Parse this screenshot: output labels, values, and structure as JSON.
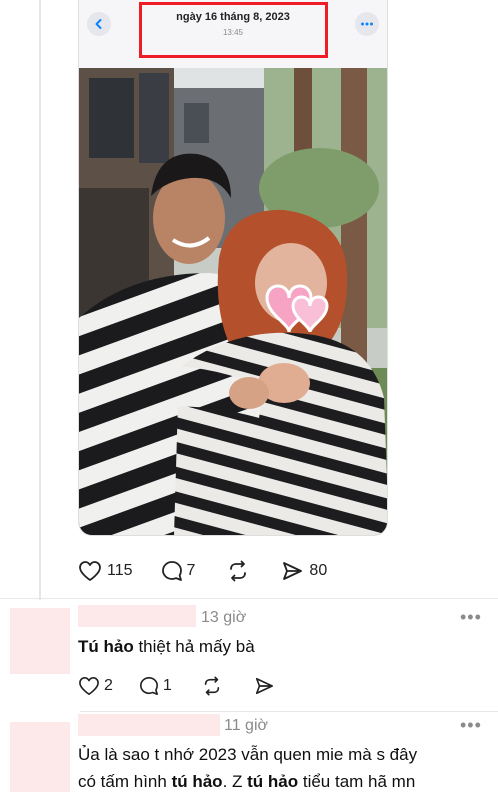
{
  "viewer": {
    "date": "ngày 16 tháng 8, 2023",
    "time": "13:45",
    "back_icon": "chevron-left-icon",
    "more_icon": "ellipsis-icon",
    "highlight_color": "#ee1c25"
  },
  "post_stats": {
    "likes": "115",
    "comments": "7",
    "reposts": "",
    "shares": "80"
  },
  "comments": [
    {
      "time": "13 giờ",
      "mention": "Tú hảo",
      "text": " thiệt hả mấy bà",
      "likes": "2",
      "replies": "1"
    },
    {
      "time": "11 giờ",
      "line1": "Ủa là sao t nhớ 2023 vẫn quen mie mà s đây",
      "line2_a": "có tấm hình ",
      "mention1": "tú hảo",
      "line2_b": ". Z ",
      "mention2": "tú hảo",
      "line2_c": " tiểu tam hã mn"
    }
  ],
  "colors": {
    "accent": "#0a84ff",
    "censor_pink": "#fde8ea",
    "muted": "#8b8b8b"
  }
}
